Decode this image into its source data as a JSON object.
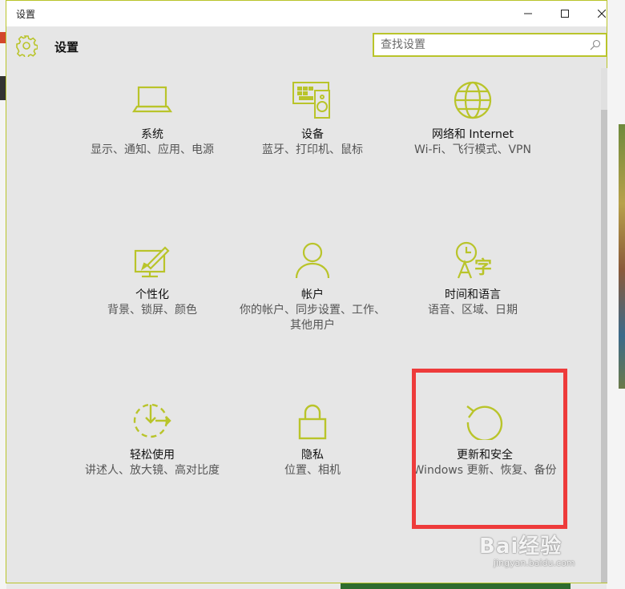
{
  "window": {
    "title": "设置"
  },
  "header": {
    "heading": "设置"
  },
  "search": {
    "placeholder": "查找设置",
    "value": ""
  },
  "tiles": [
    {
      "name": "系统",
      "desc": "显示、通知、应用、电源",
      "icon": "laptop-icon"
    },
    {
      "name": "设备",
      "desc": "蓝牙、打印机、鼠标",
      "icon": "devices-icon"
    },
    {
      "name": "网络和 Internet",
      "desc": "Wi-Fi、飞行模式、VPN",
      "icon": "globe-icon"
    },
    {
      "name": "个性化",
      "desc": "背景、锁屏、颜色",
      "icon": "personalize-icon"
    },
    {
      "name": "帐户",
      "desc": "你的帐户、同步设置、工作、其他用户",
      "icon": "person-icon"
    },
    {
      "name": "时间和语言",
      "desc": "语音、区域、日期",
      "icon": "time-language-icon"
    },
    {
      "name": "轻松使用",
      "desc": "讲述人、放大镜、高对比度",
      "icon": "ease-of-access-icon"
    },
    {
      "name": "隐私",
      "desc": "位置、相机",
      "icon": "lock-icon"
    },
    {
      "name": "更新和安全",
      "desc": "Windows 更新、恢复、备份",
      "icon": "update-icon"
    }
  ],
  "watermark": {
    "brand": "Bai经验",
    "sub": "jingyan.baidu.com"
  },
  "colors": {
    "accent": "#b9c42a",
    "highlight": "#ee3b3b"
  }
}
